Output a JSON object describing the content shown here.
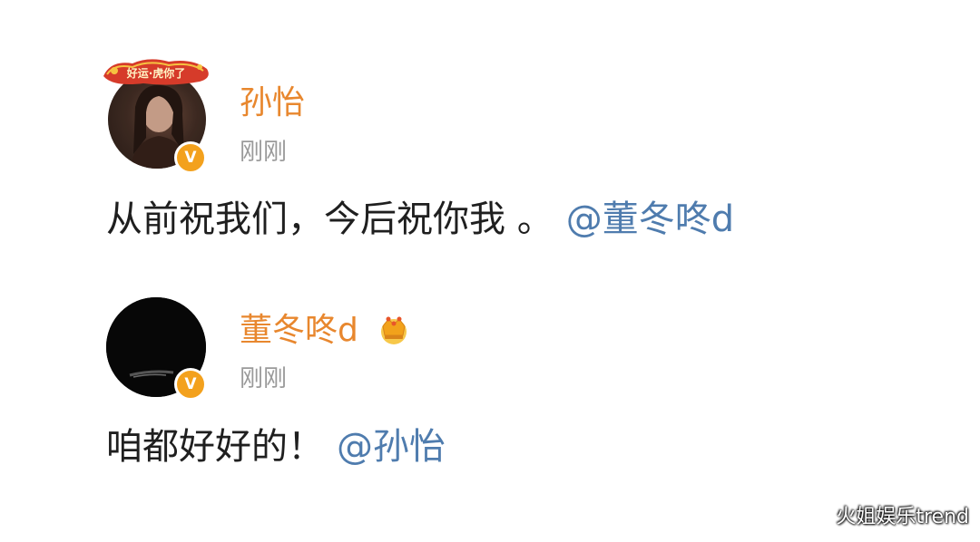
{
  "posts": [
    {
      "username": "孙怡",
      "timestamp": "刚刚",
      "text": "从前祝我们，今后祝你我 。",
      "mention": "@董冬咚d",
      "avatar_frame_text": "好运·虎你了",
      "verified_badge": "V"
    },
    {
      "username": "董冬咚d",
      "timestamp": "刚刚",
      "text": "咱都好好的！",
      "mention": "@孙怡",
      "verified_badge": "V",
      "user_badge_icon": "crown-icon"
    }
  ],
  "watermark": "火姐娱乐trend",
  "colors": {
    "username": "#e8872e",
    "timestamp": "#9a9a9a",
    "text": "#1f1f1f",
    "mention": "#4f7cae",
    "verified": "#f3a11d"
  }
}
